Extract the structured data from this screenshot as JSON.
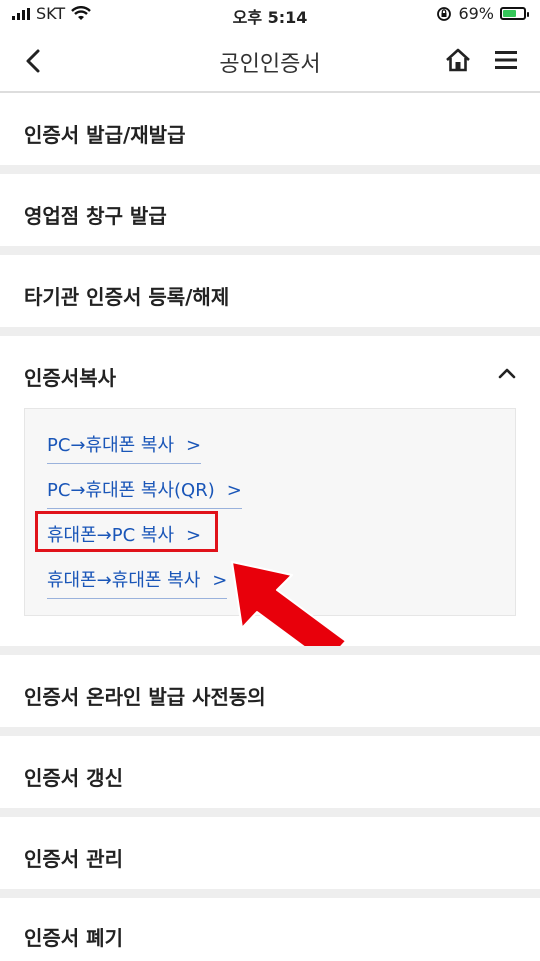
{
  "status_bar": {
    "carrier": "SKT",
    "time": "오후 5:14",
    "battery_percent": "69%",
    "battery_level": 0.69
  },
  "header": {
    "title": "공인인증서",
    "icons": [
      "back-icon",
      "home-icon",
      "menu-icon"
    ]
  },
  "menu": {
    "item_issue": "인증서 발급/재발급",
    "item_branch": "영업점 창구 발급",
    "item_other": "타기관 인증서 등록/해제",
    "item_copy": "인증서복사",
    "copy_options": [
      "PC→휴대폰 복사",
      "PC→휴대폰 복사(QR)",
      "휴대폰→PC 복사",
      "휴대폰→휴대폰 복사"
    ],
    "item_consent": "인증서 온라인 발급 사전동의",
    "item_renew": "인증서 갱신",
    "item_manage": "인증서 관리",
    "item_revoke": "인증서 폐기"
  },
  "colors": {
    "link": "#1a56b8",
    "highlight": "#e0121a",
    "arrow": "#e8000b"
  }
}
